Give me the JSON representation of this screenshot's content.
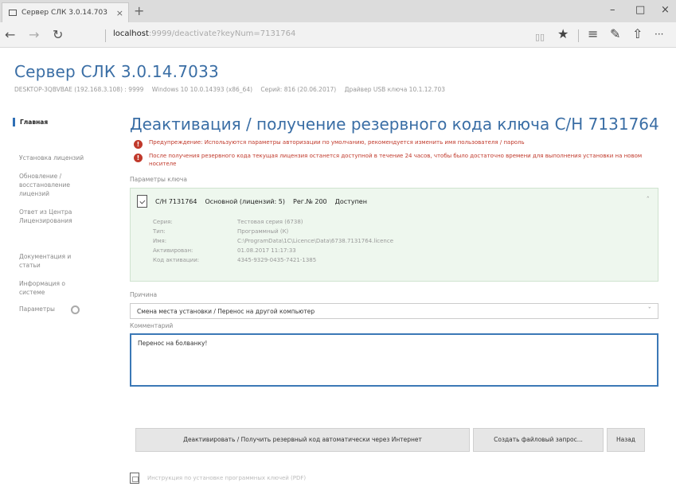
{
  "browser": {
    "tab_title": "Сервер СЛК 3.0.14.703",
    "tab_close": "×",
    "new_tab": "+",
    "url_host": "localhost",
    "url_rest": ":9999/deactivate?keyNum=7131764",
    "back": "←",
    "forward": "→",
    "refresh": "↻",
    "reading": "▯▯",
    "favorite": "★",
    "hub": "≡",
    "notes": "✎",
    "share": "⇧",
    "more": "···",
    "win_min": "–",
    "win_max": "□",
    "win_close": "×"
  },
  "app": {
    "title": "Сервер СЛК 3.0.14.7033",
    "info": [
      "DESKTOP-3QBVBAE (192.168.3.108) : 9999",
      "Windows 10 10.0.14393 (x86_64)",
      "Серий: 816 (20.06.2017)",
      "Драйвер USB ключа 10.1.12.703"
    ]
  },
  "sidebar": {
    "items": [
      {
        "label": "Главная"
      },
      {
        "label": "Установка лицензий"
      },
      {
        "label": "Обновление / восстановление лицензий"
      },
      {
        "label": "Ответ из Центра Лицензирования"
      },
      {
        "label": "Документация и статьи"
      },
      {
        "label": "Информация о системе"
      },
      {
        "label": "Параметры"
      }
    ]
  },
  "main": {
    "title": "Деактивация / получение резервного кода ключа С/Н 7131764",
    "warning1": "Предупреждение: Используются параметры авторизации по умолчанию, рекомендуется изменить имя пользователя / пароль",
    "warning2": "После получения резервного кода текущая лицензия останется доступной в течение 24 часов, чтобы было достаточно времени для выполнения установки на новом носителе",
    "key_params_label": "Параметры ключа",
    "key": {
      "serial": "С/Н 7131764",
      "type": "Основной (лицензий: 5)",
      "reg": "Рег.№ 200",
      "status": "Доступен",
      "details": [
        {
          "label": "Серия:",
          "value": "Тестовая серия (6738)"
        },
        {
          "label": "Тип:",
          "value": "Программный (К)"
        },
        {
          "label": "Имя:",
          "value": "C:\\ProgramData\\1C\\Licence\\Data\\6738.7131764.licence"
        },
        {
          "label": "Активирован:",
          "value": "01.08.2017 11:17:33"
        },
        {
          "label": "Код активации:",
          "value": "4345-9329-0435-7421-1385"
        }
      ]
    },
    "reason_label": "Причина",
    "reason_value": "Смена места установки / Перенос на другой компьютер",
    "comment_label": "Комментарий",
    "comment_value": "Перенос на болванку!",
    "buttons": {
      "deactivate": "Деактивировать / Получить резервный код автоматически через Интернет",
      "file_request": "Создать файловый запрос...",
      "back": "Назад"
    },
    "pdf_link": "Инструкция по установке программных ключей (PDF)"
  }
}
